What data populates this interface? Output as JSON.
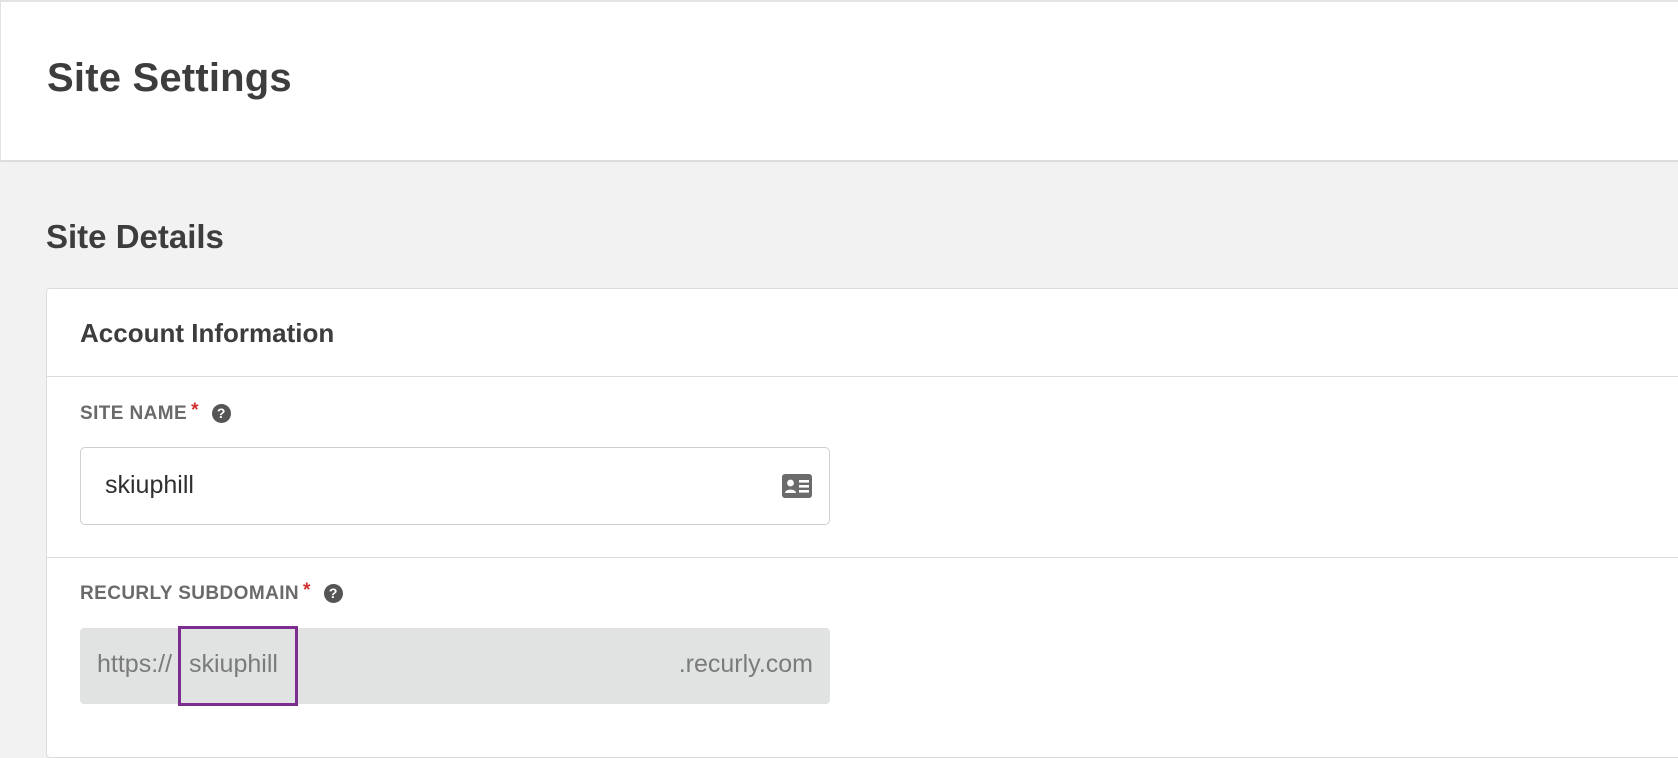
{
  "header": {
    "title": "Site Settings"
  },
  "section": {
    "title": "Site Details"
  },
  "card": {
    "title": "Account Information",
    "site_name": {
      "label": "SITE NAME",
      "required_marker": "*",
      "help_icon": "question-circle-icon",
      "value": "skiuphill",
      "trailing_icon": "id-card-icon"
    },
    "subdomain": {
      "label": "RECURLY SUBDOMAIN",
      "required_marker": "*",
      "help_icon": "question-circle-icon",
      "prefix": "https://",
      "value": "skiuphill",
      "suffix": ".recurly.com"
    }
  },
  "colors": {
    "required": "#d0312d",
    "highlight": "#7d2c8f",
    "page_background": "#f2f2f2"
  }
}
